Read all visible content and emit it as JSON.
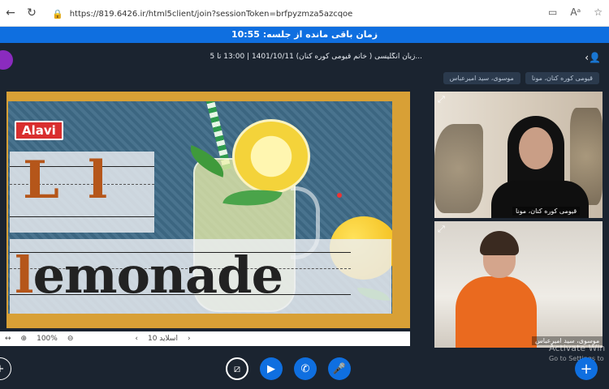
{
  "browser": {
    "url": "https://819.6426.ir/html5client/join?sessionToken=brfpyzmza5azcqoe",
    "back_icon": "arrow-left",
    "reload_icon": "reload"
  },
  "session": {
    "timer_text": "زمان باقی مانده از جلسه: 10:55",
    "title": "زبان انگلیسی ( خانم قیومی کوره کنان) 1401/10/11 | 13:00 تا 5..."
  },
  "participants": {
    "pill1": "قیومی کوره کنان، مونا",
    "pill2": "موسوی، سید امیرعباس"
  },
  "slide": {
    "brand": "Alavi",
    "upper_l": "L",
    "lower_l": "l",
    "word_first": "l",
    "word_rest": "emonade",
    "page_label": "اسلاید 10",
    "zoom": "100%"
  },
  "videos": [
    {
      "label": "قیومی کوره کنان، مونا"
    },
    {
      "label": "موسوی، سید امیرعباس"
    }
  ],
  "watermark": {
    "line1": "Activate Win",
    "line2": "Go to Settings to"
  },
  "colors": {
    "accent": "#0f6fe0",
    "app_bg": "#1b2430",
    "slide_border": "#d8a036"
  }
}
